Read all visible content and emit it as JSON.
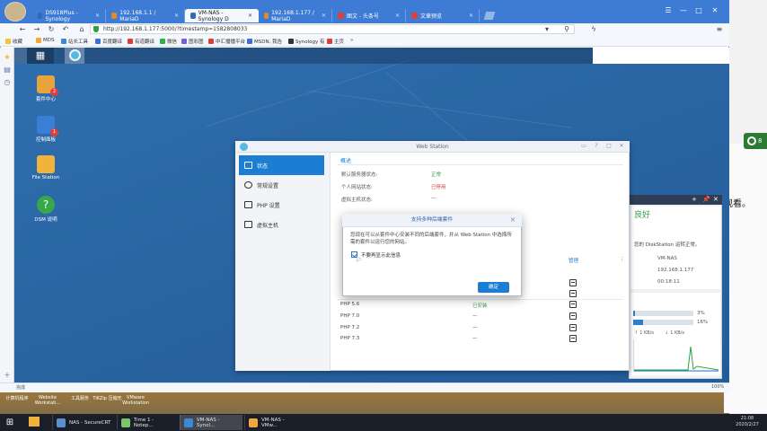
{
  "browser": {
    "tabs": [
      {
        "label": "DS918Plus - Synology"
      },
      {
        "label": "192.168.1.1 / MariaD"
      },
      {
        "label": "VM-NAS - Synology D"
      },
      {
        "label": "192.168.1.177 / MariaD"
      },
      {
        "label": "图文 - 头条号"
      },
      {
        "label": "文章预览"
      }
    ],
    "address": "http://192.168.1.177:5000/?timestamp=1582808033",
    "bookmarks": [
      "收藏",
      "MDS",
      "站长工具",
      "百度翻译",
      "有道翻译",
      "微信",
      "图彩图",
      "中汇播播平台",
      "MSDN, 我告",
      "Synology 有",
      "主页",
      "»"
    ],
    "status_text": "完成",
    "zoom": "100%",
    "window_controls": [
      "☰",
      "—",
      "□",
      "✕"
    ]
  },
  "dsm": {
    "desktop_icons": [
      {
        "label": "套件中心",
        "badge": "2",
        "color": "#e8a33a"
      },
      {
        "label": "控制面板",
        "badge": "1",
        "color": "#3a7fd6"
      },
      {
        "label": "File Station",
        "badge": "",
        "color": "#f0b43c"
      },
      {
        "label": "DSM 说明",
        "badge": "",
        "color": "#37a84a"
      }
    ]
  },
  "webstation": {
    "title": "Web Station",
    "nav": [
      {
        "label": "状态",
        "active": true
      },
      {
        "label": "常规设置",
        "active": false
      },
      {
        "label": "PHP 设置",
        "active": false
      },
      {
        "label": "虚拟主机",
        "active": false
      }
    ],
    "section_title": "概述",
    "overview": [
      {
        "label": "默认服务器状态:",
        "value": "正常",
        "color": "#2e9e3f"
      },
      {
        "label": "个人网站状态:",
        "value": "已停用",
        "color": "#d33a3a"
      },
      {
        "label": "虚拟主机状态:",
        "value": "—",
        "color": "#555"
      }
    ],
    "manage_header": "管理",
    "php_rows": [
      {
        "name": "PHP 5.6",
        "status": "已安装",
        "color": "#2e9e3f"
      },
      {
        "name": "PHP 7.0",
        "status": "—",
        "color": "#555"
      },
      {
        "name": "PHP 7.2",
        "status": "—",
        "color": "#555"
      },
      {
        "name": "PHP 7.3",
        "status": "—",
        "color": "#555"
      }
    ]
  },
  "modal": {
    "title": "支持多种后端套件",
    "body": "您现在可以从套件中心安装不同的后端套件，并从 Web Station 中选择所需的套件以运行您的网站。",
    "checkbox_label": "不要再显示此信息",
    "checkbox_checked": true,
    "ok_label": "确定"
  },
  "widgets": {
    "greeting": "良好",
    "status_msg": "您的 DiskStation 运转正常。",
    "host": "VM-NAS",
    "ip": "192.168.1.177",
    "uptime": "00:18:11",
    "cpu_pct": "3%",
    "ram_pct": "16%",
    "cpu_fraction": 0.03,
    "ram_fraction": 0.16,
    "upload": "1 KB/s",
    "download": "1 KB/s"
  },
  "behind": {
    "text": "观看。",
    "net_badge": "8"
  },
  "taskbar": {
    "tasks": [
      {
        "label": "NAS - SecureCRT",
        "color": "#5a8fd0",
        "active": false
      },
      {
        "label": "Time 1 - Notep...",
        "color": "#7cc36a",
        "active": false
      },
      {
        "label": "VM-NAS - Synol...",
        "color": "#3a8ad6",
        "active": true
      },
      {
        "label": "VM-NAS - VMw...",
        "color": "#f0a83a",
        "active": false
      }
    ],
    "clock_time": "21:08",
    "clock_date": "2020/2/27"
  },
  "lower_desktop_icons": [
    "计算机程序",
    "Website Workstati...",
    "工具服务",
    "TiKZip 压缩",
    "无",
    "VMware Workstation"
  ]
}
